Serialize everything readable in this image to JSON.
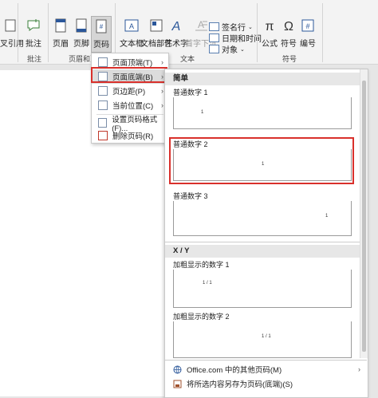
{
  "ribbon": {
    "left_partial": "叉引用",
    "groups": {
      "comment": {
        "label": "批注",
        "button": "批注"
      },
      "header_footer": {
        "label": "页眉和页",
        "header": "页眉",
        "footer": "页脚",
        "page_number": "页码"
      },
      "text": {
        "label": "文本",
        "textbox": "文本框",
        "doc_parts": "文档部件",
        "art": "艺术字",
        "drop_cap": "首字下沉",
        "signature": "签名行",
        "datetime": "日期和时间",
        "object": "对象"
      },
      "symbols": {
        "label": "符号",
        "formula": "公式",
        "symbol": "符号",
        "number": "编号"
      }
    }
  },
  "menu": {
    "items": [
      {
        "label": "页面顶端(T)",
        "submenu": true
      },
      {
        "label": "页面底端(B)",
        "submenu": true
      },
      {
        "label": "页边距(P)",
        "submenu": true
      },
      {
        "label": "当前位置(C)",
        "submenu": true
      },
      {
        "label": "设置页码格式(F)...",
        "submenu": false
      },
      {
        "label": "删除页码(R)",
        "submenu": false
      }
    ]
  },
  "gallery": {
    "section1": "简单",
    "items": [
      {
        "label": "普通数字 1",
        "num": "1"
      },
      {
        "label": "普通数字 2",
        "num": "1"
      },
      {
        "label": "普通数字 3",
        "num": "1"
      }
    ],
    "section2": "X / Y",
    "items2": [
      {
        "label": "加粗显示的数字 1",
        "num": "1 / 1"
      },
      {
        "label": "加粗显示的数字 2",
        "num": "1 / 1"
      }
    ],
    "footer": {
      "more": "Office.com 中的其他页码(M)",
      "save": "将所选内容另存为页码(底端)(S)"
    }
  },
  "colors": {
    "highlight": "#d9302b",
    "accent": "#2b579a"
  }
}
